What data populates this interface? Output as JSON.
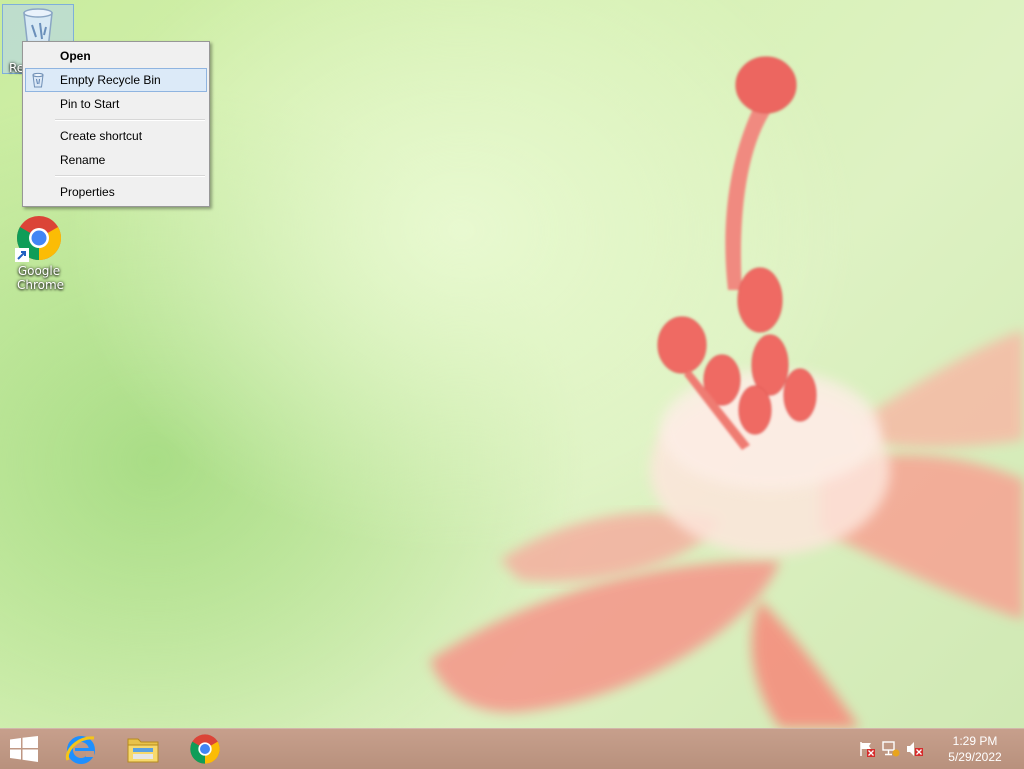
{
  "desktop": {
    "icons": [
      {
        "label": "Re",
        "icon": "recycle-bin-icon"
      },
      {
        "label": "Google Chrome",
        "icon": "chrome-icon"
      }
    ]
  },
  "context_menu": {
    "items": [
      {
        "label": "Open",
        "bold": true
      },
      {
        "label": "Empty Recycle Bin",
        "highlighted": true,
        "icon": "recycle-bin-small-icon"
      },
      {
        "label": "Pin to Start"
      },
      {
        "label": "Create shortcut"
      },
      {
        "label": "Rename"
      },
      {
        "label": "Properties"
      }
    ]
  },
  "taskbar": {
    "pinned": [
      {
        "name": "Internet Explorer",
        "icon": "ie-icon"
      },
      {
        "name": "File Explorer",
        "icon": "folder-icon"
      },
      {
        "name": "Google Chrome",
        "icon": "chrome-icon"
      }
    ],
    "tray_icons": [
      "action-center-flag-icon",
      "network-icon",
      "volume-muted-icon"
    ],
    "clock": {
      "time": "1:29 PM",
      "date": "5/29/2022"
    }
  },
  "colors": {
    "taskbar": "#bf9886",
    "menu_highlight": "#dceaf8",
    "menu_bg": "#f0f0f0"
  }
}
